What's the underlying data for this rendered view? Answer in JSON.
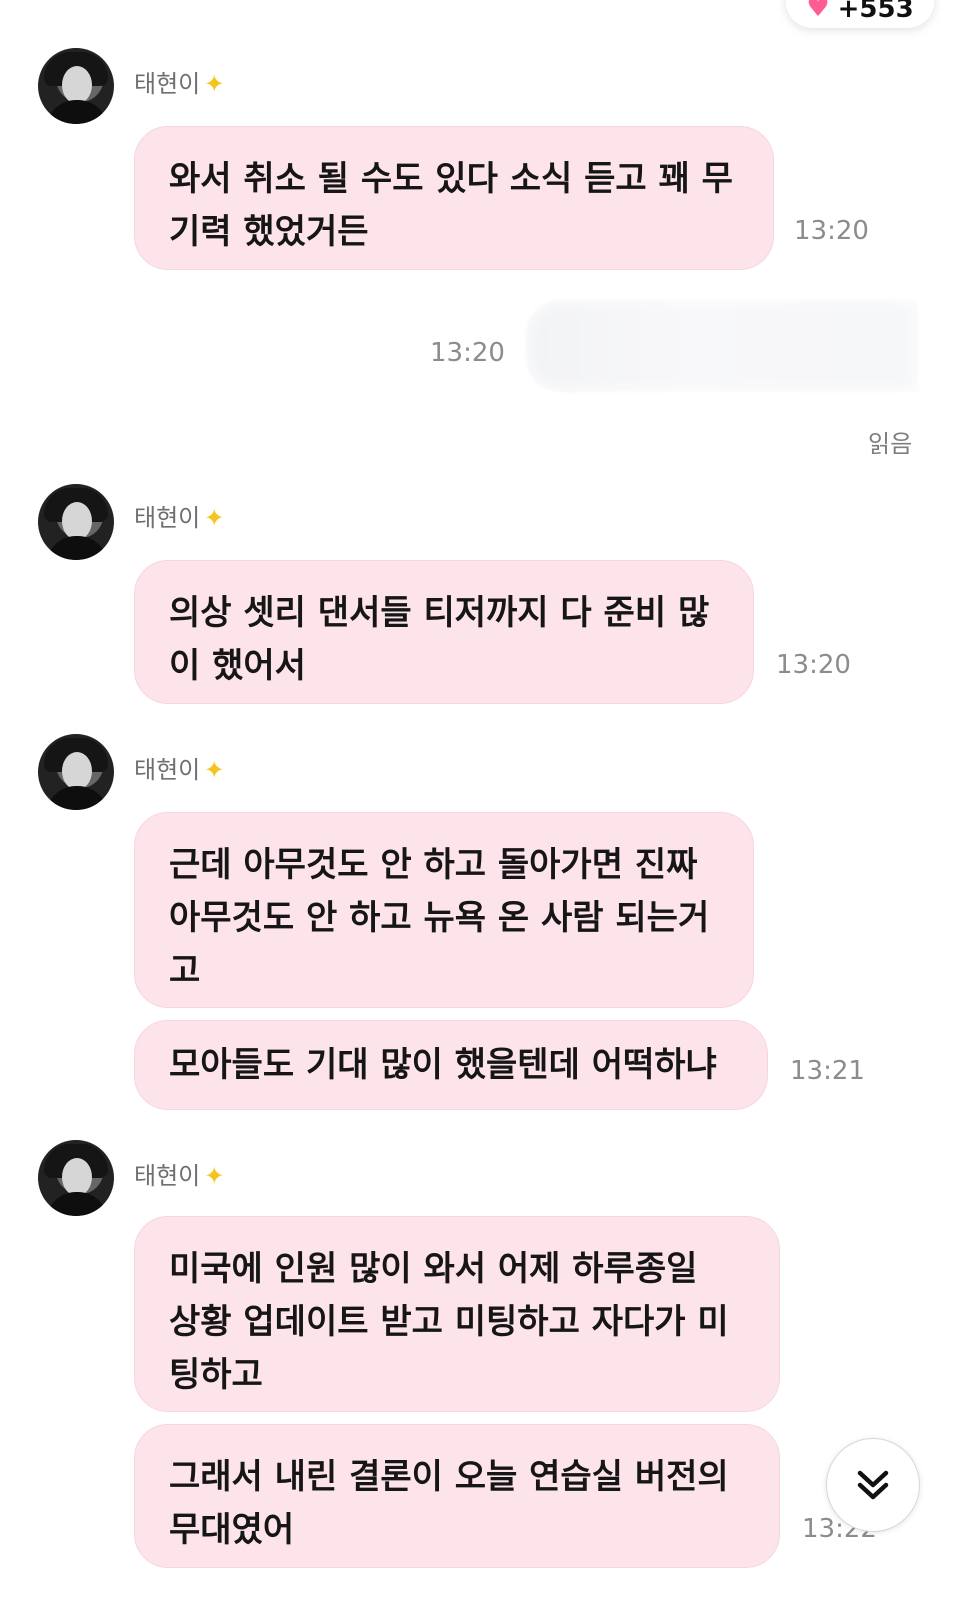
{
  "top_badge": {
    "heart_icon": "heart-icon",
    "count": "+553"
  },
  "messages": [
    {
      "sender": "태현이",
      "icon": "star-icon",
      "bubbles": [
        {
          "text": "와서 취소 될 수도 있다 소식 듣고 꽤 무\n기력 했었거든"
        }
      ],
      "time": "13:20"
    },
    {
      "outgoing_time": "13:20",
      "read_label": "읽음"
    },
    {
      "sender": "태현이",
      "icon": "star-icon",
      "bubbles": [
        {
          "text": "의상 셋리 댄서들 티저까지 다 준비 많\n이 했어서"
        }
      ],
      "time": "13:20"
    },
    {
      "sender": "태현이",
      "icon": "star-icon",
      "bubbles": [
        {
          "text": "근데 아무것도 안 하고 돌아가면 진짜\n아무것도 안 하고 뉴욕 온 사람 되는거\n고"
        },
        {
          "text": "모아들도 기대 많이 했을텐데 어떡하냐"
        }
      ],
      "time": "13:21"
    },
    {
      "sender": "태현이",
      "icon": "star-icon",
      "bubbles": [
        {
          "text": "미국에 인원 많이 와서 어제 하루종일\n상황 업데이트 받고 미팅하고 자다가 미\n팅하고"
        },
        {
          "text": "그래서 내린 결론이 오늘 연습실 버전의\n무대였어"
        }
      ],
      "time": "13:22"
    }
  ],
  "controls": {
    "scroll_down_icon": "double-chevron-down-icon"
  },
  "colors": {
    "bubble_bg": "#fde4ea",
    "time_text": "#8c8c8c",
    "accent_heart": "#ff5c93"
  }
}
